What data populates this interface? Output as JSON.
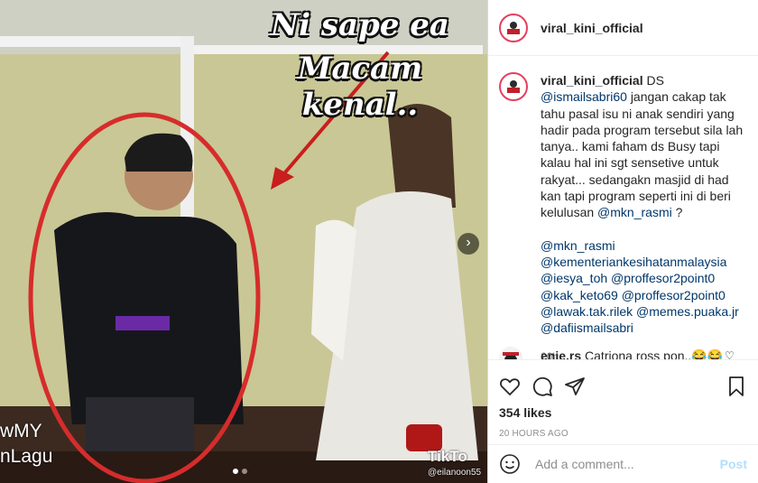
{
  "media": {
    "overlay_line1": "Ni sape ea",
    "overlay_line2": "Macam kenal..",
    "watermark_left_1": "wMY",
    "watermark_left_2": "nLagu",
    "tiktok_label": "TikTo",
    "tiktok_user": "@eilanoon55",
    "next_icon": "chevron-right-icon",
    "circle_color": "#d62c2c"
  },
  "account": {
    "username": "viral_kini_official"
  },
  "caption": {
    "username": "viral_kini_official",
    "first_word": "DS",
    "mention_1": "@ismailsabri60",
    "text_1": "jangan cakap tak tahu pasal isu ni anak sendiri yang hadir pada program tersebut sila lah tanya.. kami faham ds Busy tapi kalau hal ini sgt sensetive untuk rakyat... sedangakn masjid di had kan tapi program seperti ini di beri kelulusan",
    "mention_2": "@mkn_rasmi",
    "text_2": "?",
    "tags": [
      "@mkn_rasmi",
      "@kementeriankesihatanmalaysia",
      "@iesya_toh @proffesor2point0",
      "@kak_keto69 @proffesor2point0",
      "@lawak.tak.rilek @memes.puaka.jr",
      "@dafiismailsabri"
    ],
    "time": "20h"
  },
  "comment": {
    "username": "enie.rs",
    "text": "Catriona ross pon..😂😂"
  },
  "likes": "354 likes",
  "posted_ago": "20 HOURS AGO",
  "add_comment": {
    "placeholder": "Add a comment...",
    "post_label": "Post"
  },
  "colors": {
    "mention": "#00376b",
    "post_button": "#b2dffc",
    "avatar_ring": "#e4405f"
  }
}
